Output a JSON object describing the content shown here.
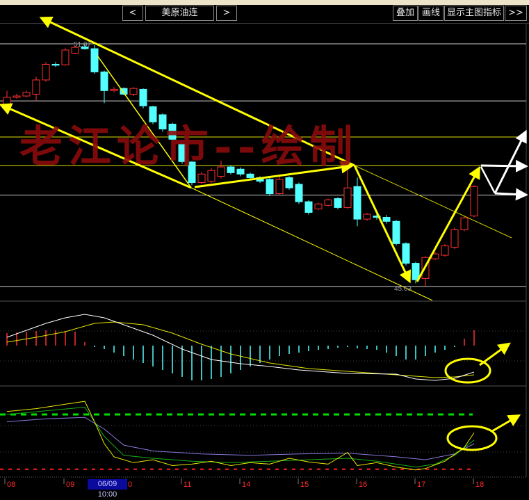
{
  "toolbar": {
    "prev_label": "<",
    "symbol": "美原油连",
    "next_label": ">",
    "overlay_label": "叠加",
    "draw_label": "画线",
    "show_indicator_label": "显示主图指标",
    "more_label": ">>"
  },
  "watermark": "老江论市--绘制",
  "colors": {
    "up": "#ff3030",
    "down": "#54ffff",
    "annotation": "#ffff00",
    "bg": "#000000"
  },
  "chart_data": {
    "type": "candlestick",
    "high_label": "51.07",
    "low_label": "45.63",
    "price_range": [
      45.3,
      51.8
    ],
    "horizontal_levels": [
      51.07,
      49.79,
      48.98,
      48.34,
      47.68,
      45.63
    ],
    "candles": [
      [
        49.71,
        49.87,
        50.02,
        49.59
      ],
      [
        49.87,
        49.9,
        49.95,
        49.84
      ],
      [
        49.9,
        49.98,
        50.02,
        49.87
      ],
      [
        49.94,
        50.26,
        50.33,
        49.79
      ],
      [
        50.26,
        50.61,
        50.66,
        50.22
      ],
      [
        50.61,
        50.59,
        50.66,
        50.55
      ],
      [
        50.6,
        50.93,
        50.98,
        50.58
      ],
      [
        50.86,
        50.99,
        51.03,
        50.84
      ],
      [
        51.0,
        50.96,
        51.07,
        50.94
      ],
      [
        50.96,
        50.44,
        51.04,
        50.4
      ],
      [
        50.44,
        50.02,
        50.47,
        49.74
      ],
      [
        50.02,
        50.05,
        50.1,
        49.98
      ],
      [
        50.07,
        49.94,
        50.09,
        49.92
      ],
      [
        49.94,
        50.07,
        50.1,
        49.9
      ],
      [
        50.05,
        49.68,
        50.07,
        49.62
      ],
      [
        49.66,
        49.32,
        49.68,
        49.27
      ],
      [
        49.48,
        49.16,
        49.51,
        49.1
      ],
      [
        49.27,
        48.93,
        49.3,
        48.88
      ],
      [
        48.82,
        48.43,
        48.85,
        48.38
      ],
      [
        48.42,
        47.96,
        48.44,
        47.9
      ],
      [
        47.96,
        48.15,
        48.2,
        47.92
      ],
      [
        47.99,
        48.23,
        48.28,
        47.95
      ],
      [
        48.1,
        48.31,
        48.45,
        48.05
      ],
      [
        48.31,
        48.18,
        48.35,
        48.14
      ],
      [
        48.26,
        48.15,
        48.3,
        48.1
      ],
      [
        48.15,
        48.07,
        48.18,
        48.03
      ],
      [
        48.07,
        47.99,
        48.1,
        47.95
      ],
      [
        48.03,
        47.71,
        48.06,
        47.66
      ],
      [
        47.71,
        48.03,
        48.09,
        47.68
      ],
      [
        48.07,
        47.84,
        48.1,
        47.8
      ],
      [
        47.92,
        47.53,
        47.96,
        47.48
      ],
      [
        47.53,
        47.29,
        47.56,
        47.24
      ],
      [
        47.37,
        47.48,
        47.51,
        47.34
      ],
      [
        47.45,
        47.57,
        47.6,
        47.42
      ],
      [
        47.6,
        47.4,
        47.63,
        47.36
      ],
      [
        47.4,
        47.84,
        48.31,
        47.37
      ],
      [
        47.87,
        47.14,
        48.07,
        46.98
      ],
      [
        47.14,
        47.25,
        47.28,
        47.1
      ],
      [
        47.21,
        47.18,
        47.26,
        47.13
      ],
      [
        47.18,
        47.09,
        47.23,
        47.04
      ],
      [
        47.09,
        46.59,
        47.12,
        46.55
      ],
      [
        46.59,
        46.15,
        46.62,
        46.1
      ],
      [
        46.15,
        45.78,
        46.18,
        45.7
      ],
      [
        45.81,
        46.28,
        46.31,
        45.63
      ],
      [
        46.25,
        46.36,
        46.4,
        46.22
      ],
      [
        46.33,
        46.54,
        46.58,
        46.3
      ],
      [
        46.51,
        46.9,
        46.95,
        46.47
      ],
      [
        46.9,
        47.17,
        47.2,
        46.87
      ],
      [
        47.21,
        47.87,
        47.9,
        47.18
      ]
    ],
    "macd": {
      "histogram": [
        0.18,
        0.19,
        0.2,
        0.21,
        0.22,
        0.22,
        0.21,
        0.2,
        0.05,
        -0.02,
        -0.05,
        -0.1,
        -0.15,
        -0.2,
        -0.25,
        -0.3,
        -0.35,
        -0.4,
        -0.45,
        -0.5,
        -0.5,
        -0.48,
        -0.45,
        -0.4,
        -0.35,
        -0.3,
        -0.25,
        -0.2,
        -0.15,
        -0.12,
        -0.1,
        -0.08,
        -0.06,
        -0.05,
        -0.03,
        -0.02,
        -0.04,
        -0.05,
        -0.06,
        -0.1,
        -0.15,
        -0.2,
        -0.2,
        -0.15,
        -0.1,
        -0.06,
        -0.02,
        0.1,
        0.22
      ],
      "dif": [
        [
          0,
          0.12
        ],
        [
          2,
          0.22
        ],
        [
          4,
          0.32
        ],
        [
          6,
          0.4
        ],
        [
          8,
          0.45
        ],
        [
          10,
          0.4
        ],
        [
          12,
          0.3
        ],
        [
          15,
          0.15
        ],
        [
          18,
          -0.05
        ],
        [
          21,
          -0.2
        ],
        [
          24,
          -0.26
        ],
        [
          27,
          -0.3
        ],
        [
          30,
          -0.35
        ],
        [
          35,
          -0.4
        ],
        [
          40,
          -0.41
        ],
        [
          42,
          -0.48
        ],
        [
          44,
          -0.5
        ],
        [
          46,
          -0.47
        ],
        [
          48,
          -0.38
        ]
      ],
      "dea": [
        [
          0,
          0.05
        ],
        [
          3,
          0.12
        ],
        [
          6,
          0.2
        ],
        [
          9,
          0.32
        ],
        [
          11,
          0.34
        ],
        [
          14,
          0.3
        ],
        [
          17,
          0.18
        ],
        [
          20,
          0.02
        ],
        [
          23,
          -0.12
        ],
        [
          27,
          -0.25
        ],
        [
          31,
          -0.33
        ],
        [
          36,
          -0.38
        ],
        [
          41,
          -0.43
        ],
        [
          44,
          -0.46
        ],
        [
          46,
          -0.45
        ],
        [
          48,
          -0.42
        ]
      ]
    },
    "oscillator": {
      "upper_level": 80,
      "lower_level": 5,
      "fast": [
        [
          0,
          84
        ],
        [
          3,
          88
        ],
        [
          6,
          94
        ],
        [
          8,
          98
        ],
        [
          9,
          70
        ],
        [
          10,
          40
        ],
        [
          11,
          22
        ],
        [
          13,
          14
        ],
        [
          15,
          18
        ],
        [
          17,
          10
        ],
        [
          19,
          12
        ],
        [
          21,
          16
        ],
        [
          23,
          10
        ],
        [
          25,
          14
        ],
        [
          27,
          12
        ],
        [
          29,
          20
        ],
        [
          31,
          15
        ],
        [
          33,
          12
        ],
        [
          35,
          28
        ],
        [
          36,
          10
        ],
        [
          38,
          14
        ],
        [
          40,
          8
        ],
        [
          42,
          4
        ],
        [
          43,
          6
        ],
        [
          45,
          16
        ],
        [
          47,
          35
        ],
        [
          48,
          55
        ]
      ],
      "mid": [
        [
          0,
          80
        ],
        [
          4,
          85
        ],
        [
          8,
          90
        ],
        [
          10,
          50
        ],
        [
          12,
          24
        ],
        [
          15,
          20
        ],
        [
          19,
          16
        ],
        [
          23,
          14
        ],
        [
          27,
          16
        ],
        [
          31,
          18
        ],
        [
          35,
          20
        ],
        [
          38,
          16
        ],
        [
          42,
          8
        ],
        [
          44,
          12
        ],
        [
          46,
          24
        ],
        [
          48,
          45
        ]
      ],
      "slow": [
        [
          0,
          70
        ],
        [
          4,
          74
        ],
        [
          8,
          76
        ],
        [
          10,
          60
        ],
        [
          12,
          38
        ],
        [
          15,
          30
        ],
        [
          20,
          26
        ],
        [
          25,
          24
        ],
        [
          30,
          26
        ],
        [
          35,
          27
        ],
        [
          40,
          22
        ],
        [
          43,
          18
        ],
        [
          46,
          26
        ],
        [
          48,
          40
        ]
      ]
    },
    "x_ticks": [
      "08",
      "09",
      "0",
      "11",
      "14",
      "15",
      "16",
      "17",
      "18"
    ],
    "cursor_label": "06/09 10:00"
  }
}
